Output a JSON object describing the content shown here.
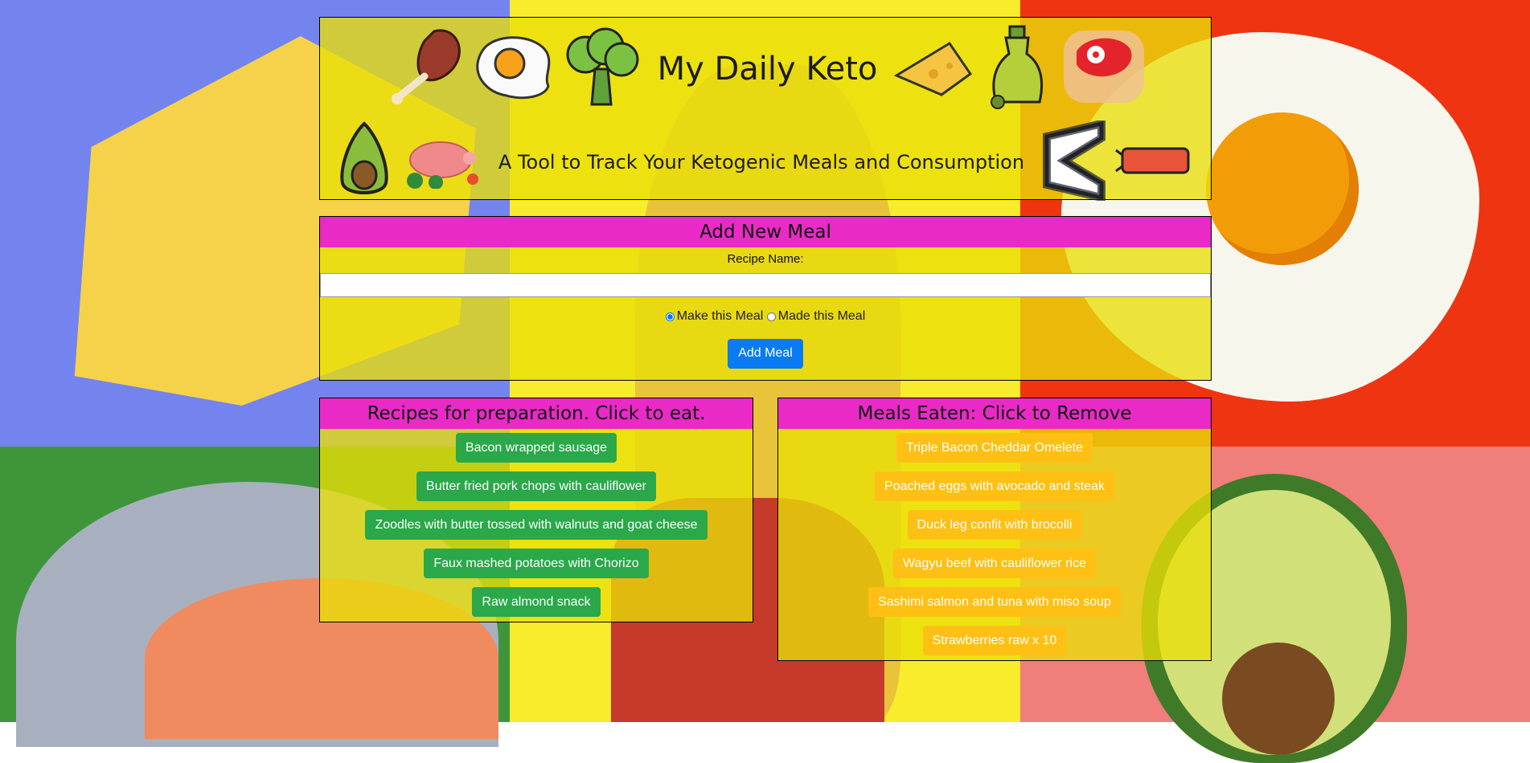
{
  "header": {
    "title": "My Daily Keto",
    "subtitle": "A Tool to Track Your Ketogenic Meals and Consumption"
  },
  "add_meal": {
    "heading": "Add New Meal",
    "recipe_label": "Recipe Name:",
    "recipe_value": "",
    "recipe_placeholder": "",
    "radio_make": "Make this Meal",
    "radio_made": "Made this Meal",
    "button": "Add Meal"
  },
  "recipes": {
    "heading": "Recipes for preparation. Click to eat.",
    "items": [
      "Bacon wrapped sausage",
      "Butter fried pork chops with cauliflower",
      "Zoodles with butter tossed with walnuts and goat cheese",
      "Faux mashed potatoes with Chorizo",
      "Raw almond snack"
    ]
  },
  "eaten": {
    "heading": "Meals Eaten: Click to Remove",
    "items": [
      "Triple Bacon Cheddar Omelete",
      "Poached eggs with avocado and steak",
      "Duck leg confit with brocolli",
      "Wagyu beef with cauliflower rice",
      "Sashimi salmon and tuna with miso soup",
      "Strawberries raw x 10"
    ]
  },
  "colors": {
    "panel": "#e9df08",
    "heading_bar": "#e92ac6",
    "primary_button": "#0a7bf2",
    "recipe_button": "#2aa84a",
    "eaten_button": "#fec015"
  },
  "icons": [
    "ham-icon",
    "fried-egg-icon",
    "broccoli-icon",
    "cheese-icon",
    "olive-oil-icon",
    "steak-icon",
    "avocado-icon",
    "pig-icon",
    "measuring-tape-icon",
    "sausage-icon"
  ]
}
